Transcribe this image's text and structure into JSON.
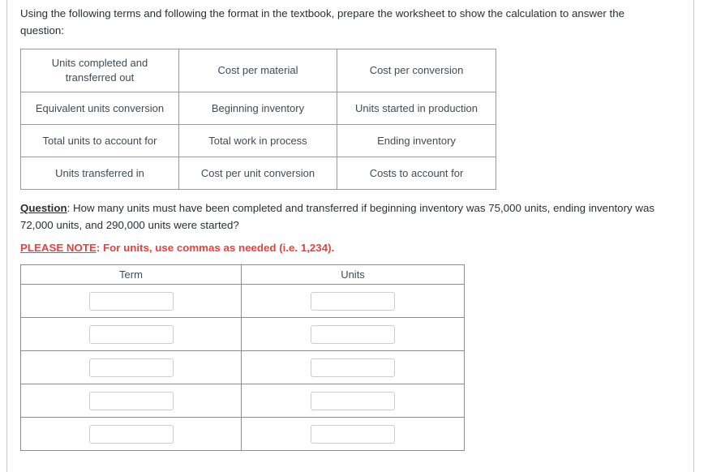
{
  "intro": {
    "text": "Using the following terms and following the format in the textbook, prepare the worksheet to show the calculation to answer the question:"
  },
  "terms_table": {
    "name": "terms-reference-table",
    "rows": [
      [
        "Units completed and transferred out",
        "Cost per material",
        "Cost per conversion"
      ],
      [
        "Equivalent units conversion",
        "Beginning inventory",
        "Units started in production"
      ],
      [
        "Total units to account for",
        "Total work in process",
        "Ending inventory"
      ],
      [
        "Units transferred in",
        "Cost per unit conversion",
        "Costs to account for"
      ]
    ]
  },
  "question": {
    "lead": "Question",
    "separator": ": ",
    "text": "How many units must have been completed and transferred if beginning inventory was 75,000 units, ending inventory was 72,000 units, and 290,000 units were started?"
  },
  "note": {
    "lead": "PLEASE NOTE",
    "separator": ": ",
    "text": "For units, use commas as needed (i.e. 1,234).",
    "color": "#e8423f"
  },
  "answer_table": {
    "headers": [
      "Term",
      "Units"
    ],
    "rows": [
      {
        "term": "",
        "units": ""
      },
      {
        "term": "",
        "units": ""
      },
      {
        "term": "",
        "units": ""
      },
      {
        "term": "",
        "units": ""
      },
      {
        "term": "",
        "units": ""
      }
    ],
    "input_placeholder": ""
  }
}
